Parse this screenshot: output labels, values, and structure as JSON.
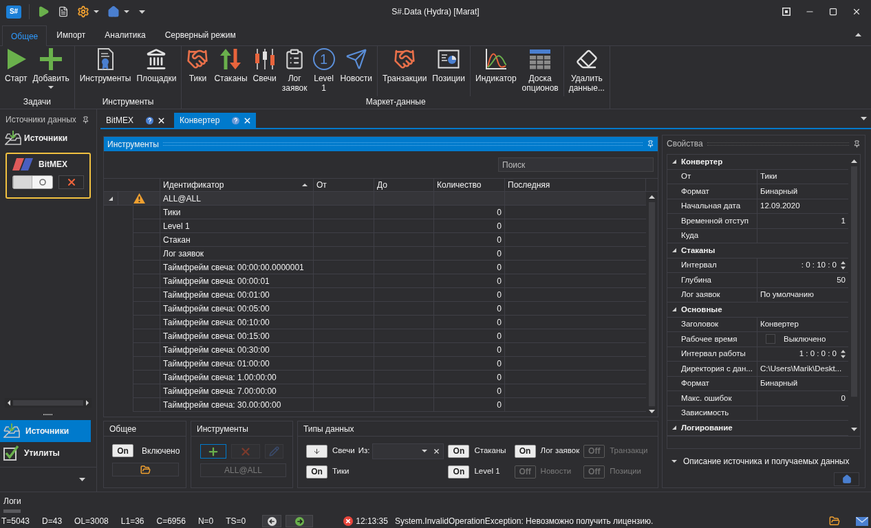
{
  "window": {
    "logo": "S#",
    "title": "S#.Data (Hydra) [Marat]"
  },
  "ribbon": {
    "tabs": [
      {
        "label": "Общее",
        "selected": true
      },
      {
        "label": "Импорт",
        "selected": false
      },
      {
        "label": "Аналитика",
        "selected": false
      },
      {
        "label": "Серверный режим",
        "selected": false
      }
    ],
    "groups": [
      {
        "label": "Задачи",
        "sections": [
          [
            {
              "label": "Старт",
              "dropdown": false
            },
            {
              "label": "Добавить",
              "dropdown": true
            }
          ]
        ]
      },
      {
        "label": "Инструменты",
        "sections": [
          [
            {
              "label": "Инструменты",
              "dropdown": false
            },
            {
              "label": "Площадки",
              "dropdown": false
            }
          ]
        ]
      },
      {
        "label": "Маркет-данные",
        "sections": [
          [
            {
              "label": "Тики",
              "dropdown": false
            },
            {
              "label": "Стаканы",
              "dropdown": false
            },
            {
              "label": "Свечи",
              "dropdown": false
            },
            {
              "label": "Лог заявок",
              "dropdown": false
            },
            {
              "label": "Level 1",
              "glyph": "1",
              "dropdown": false
            },
            {
              "label": "Новости",
              "dropdown": false
            }
          ],
          [
            {
              "label": "Транзакции",
              "dropdown": false
            },
            {
              "label": "Позиции",
              "dropdown": false
            }
          ],
          [
            {
              "label": "Индикатор",
              "dropdown": false
            },
            {
              "label": "Доска опционов",
              "dropdown": false
            }
          ],
          [
            {
              "label": "Удалить данные...",
              "dropdown": false
            }
          ]
        ]
      }
    ]
  },
  "sources_panel": {
    "title": "Источники данных",
    "heading": "Источники",
    "sources": [
      {
        "name": "BitMEX",
        "selected": true,
        "enabled": false
      }
    ]
  },
  "sidebar_nav": [
    {
      "label": "Источники",
      "selected": true
    },
    {
      "label": "Утилиты",
      "selected": false
    }
  ],
  "document_tabs": [
    {
      "label": "BitMEX",
      "selected": false
    },
    {
      "label": "Конвертер",
      "selected": true
    }
  ],
  "instruments_panel": {
    "title": "Инструменты",
    "search": {
      "placeholder": "Поиск"
    },
    "columns": [
      {
        "label": "Идентификатор",
        "sorted": true
      },
      {
        "label": "От",
        "sorted": false
      },
      {
        "label": "До",
        "sorted": false
      },
      {
        "label": "Количество",
        "sorted": false
      },
      {
        "label": "Последняя",
        "sorted": false
      }
    ],
    "rows": [
      {
        "label": "ALL@ALL",
        "expanded": true,
        "warning": true,
        "children": [
          {
            "label": "Тики",
            "count": "0"
          },
          {
            "label": "Level 1",
            "count": "0"
          },
          {
            "label": "Стакан",
            "count": "0"
          },
          {
            "label": "Лог заявок",
            "count": "0"
          },
          {
            "label": "Таймфрейм свеча: 00:00:00.0000001",
            "count": "0"
          },
          {
            "label": "Таймфрейм свеча: 00:00:01",
            "count": "0"
          },
          {
            "label": "Таймфрейм свеча: 00:01:00",
            "count": "0"
          },
          {
            "label": "Таймфрейм свеча: 00:05:00",
            "count": "0"
          },
          {
            "label": "Таймфрейм свеча: 00:10:00",
            "count": "0"
          },
          {
            "label": "Таймфрейм свеча: 00:15:00",
            "count": "0"
          },
          {
            "label": "Таймфрейм свеча: 00:30:00",
            "count": "0"
          },
          {
            "label": "Таймфрейм свеча: 01:00:00",
            "count": "0"
          },
          {
            "label": "Таймфрейм свеча: 1.00:00:00",
            "count": "0"
          },
          {
            "label": "Таймфрейм свеча: 7.00:00:00",
            "count": "0"
          },
          {
            "label": "Таймфрейм свеча: 30.00:00:00",
            "count": "0"
          }
        ]
      }
    ]
  },
  "general_box": {
    "title": "Общее",
    "toggle": {
      "text": "On",
      "on": true
    },
    "label": "Включено"
  },
  "instruments_box": {
    "title": "Инструменты",
    "buttons": [
      {
        "disabled": false
      },
      {
        "disabled": true
      },
      {
        "disabled": true
      }
    ],
    "selection": "ALL@ALL"
  },
  "data_types_box": {
    "title": "Типы данных",
    "candles": {
      "label": "Свечи",
      "source_label": "Из:"
    },
    "toggles": [
      {
        "text": "On",
        "on": true,
        "label": "Тики"
      },
      {
        "text": "On",
        "on": true,
        "label": "Стаканы"
      },
      {
        "text": "On",
        "on": true,
        "label": "Level 1"
      },
      {
        "text": "On",
        "on": true,
        "label": "Лог заявок"
      },
      {
        "text": "Off",
        "on": false,
        "label": "Новости"
      },
      {
        "text": "Off",
        "on": false,
        "label": "Транзакци"
      },
      {
        "text": "Off",
        "on": false,
        "label": "Позиции"
      }
    ]
  },
  "properties_panel": {
    "title": "Свойства",
    "categories": [
      {
        "name": "Конвертер",
        "expanded": true,
        "properties": [
          {
            "name": "От",
            "kind": "text",
            "value": "Тики"
          },
          {
            "name": "Формат",
            "kind": "text",
            "value": "Бинарный"
          },
          {
            "name": "Начальная дата",
            "kind": "text",
            "value": "12.09.2020"
          },
          {
            "name": "Временной отступ",
            "kind": "number",
            "value": "1"
          },
          {
            "name": "Куда",
            "kind": "text"
          }
        ]
      },
      {
        "name": "Стаканы",
        "expanded": true,
        "properties": [
          {
            "name": "Интервал",
            "kind": "timespan",
            "value": ": 0 : 10 : 0"
          },
          {
            "name": "Глубина",
            "kind": "number",
            "value": "50"
          },
          {
            "name": "Лог заявок",
            "kind": "text",
            "value": "По умолчанию"
          }
        ]
      },
      {
        "name": "Основные",
        "expanded": true,
        "properties": [
          {
            "name": "Заголовок",
            "kind": "text",
            "value": "Конвертер"
          },
          {
            "name": "Рабочее время",
            "kind": "checkbox",
            "checked": false,
            "value": "Выключено"
          },
          {
            "name": "Интервал работы",
            "kind": "timespan",
            "value": "1 : 0 : 0 : 0"
          },
          {
            "name": "Директория с дан...",
            "kind": "text",
            "value": "C:\\Users\\Marik\\Deskt..."
          },
          {
            "name": "Формат",
            "kind": "text",
            "value": "Бинарный"
          },
          {
            "name": "Макс. ошибок",
            "kind": "number",
            "value": "0"
          },
          {
            "name": "Зависимость",
            "kind": "text"
          }
        ]
      },
      {
        "name": "Логирование",
        "expanded": true
      }
    ],
    "description": "Описание источника и получаемых данных"
  },
  "logs": {
    "title": "Логи"
  },
  "status_bar": {
    "counters": [
      "T=5043",
      "D=43",
      "OL=3008",
      "L1=36",
      "C=6956",
      "N=0",
      "TS=0"
    ],
    "time": "12:13:35",
    "message": "System.InvalidOperationException: Невозможно получить лицензию."
  }
}
